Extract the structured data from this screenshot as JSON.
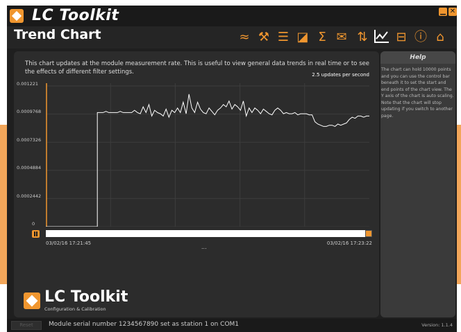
{
  "app": {
    "title": "LC Toolkit"
  },
  "window_buttons": {
    "minimize": "▁",
    "close": "✕"
  },
  "page": {
    "title": "Trend Chart"
  },
  "toolbar": {
    "icons": [
      "filter-wave-icon",
      "settings-tools-icon",
      "list-settings-icon",
      "calibrate-ruler-icon",
      "sigma-icon",
      "signal-mail-icon",
      "io-icon",
      "trend-chart-icon",
      "storage-icon",
      "info-icon",
      "home-icon"
    ]
  },
  "description": "This chart updates at the module measurement rate. This is useful to view general data trends in real time or to see the effects of different filter settings.",
  "update_rate": "2.5 updates per second",
  "chart_data": {
    "type": "line",
    "title": "",
    "xlabel": "",
    "ylabel": "",
    "y_ticks": [
      "0.001221",
      "0.0009768",
      "0.0007326",
      "0.0004884",
      "0.0002442",
      "0"
    ],
    "ylim": [
      0,
      0.001221
    ],
    "start_time": "03/02/16 17:21:45",
    "end_time": "03/02/16 17:23:22",
    "series": [
      {
        "color": "#ffffff",
        "values": [
          0,
          0,
          0,
          0,
          0,
          0,
          0,
          0,
          0,
          0,
          0,
          0,
          0,
          0,
          0,
          0,
          0,
          0,
          0.00099,
          0.00099,
          0.00099,
          0.001,
          0.00099,
          0.00099,
          0.00099,
          0.00099,
          0.001,
          0.00099,
          0.00099,
          0.00099,
          0.00099,
          0.00101,
          0.00099,
          0.00098,
          0.00104,
          0.00099,
          0.00106,
          0.00096,
          0.00101,
          0.00099,
          0.00098,
          0.00096,
          0.00102,
          0.00095,
          0.00101,
          0.00099,
          0.00103,
          0.00099,
          0.00108,
          0.00098,
          0.00115,
          0.00103,
          0.00099,
          0.00108,
          0.00102,
          0.00099,
          0.00098,
          0.00103,
          0.001,
          0.00097,
          0.00101,
          0.00103,
          0.00106,
          0.00104,
          0.00109,
          0.00102,
          0.00106,
          0.00104,
          0.00101,
          0.00109,
          0.00096,
          0.00103,
          0.00099,
          0.00103,
          0.00101,
          0.00098,
          0.00102,
          0.001,
          0.00098,
          0.00097,
          0.00101,
          0.00103,
          0.00101,
          0.00098,
          0.00099,
          0.00098,
          0.00098,
          0.00099,
          0.00097,
          0.00098,
          0.00098,
          0.00098,
          0.00097,
          0.00097,
          0.00091,
          0.00089,
          0.00088,
          0.00087,
          0.00087,
          0.00088,
          0.00088,
          0.00087,
          0.00089,
          0.00088,
          0.00089,
          0.0009,
          0.00093,
          0.00095,
          0.00094,
          0.00096,
          0.00096,
          0.00095,
          0.00096,
          0.00096
        ]
      }
    ],
    "grid": true,
    "accent_color": "#f0962f"
  },
  "timeline": {
    "start": "03/02/16 17:21:45",
    "end": "03/02/16 17:23:22",
    "ellipsis": "..."
  },
  "brand": {
    "name": "LC Toolkit",
    "subtitle": "Configuration & Calibration"
  },
  "help": {
    "title": "Help",
    "text": "The chart can hold 10000 points and you can use the control bar beneath it to set the start and end points of the chart view. The Y axis of the chart is auto scaling. Note that the chart will stop updating if you switch to another page."
  },
  "status": {
    "reset_label": "Reset",
    "message": "Module serial number 1234567890 set as station 1 on COM1",
    "version": "Version: 1.1.4"
  },
  "colors": {
    "accent": "#f0962f",
    "background": "#1f1f1f",
    "panel": "#2c2c2c"
  }
}
